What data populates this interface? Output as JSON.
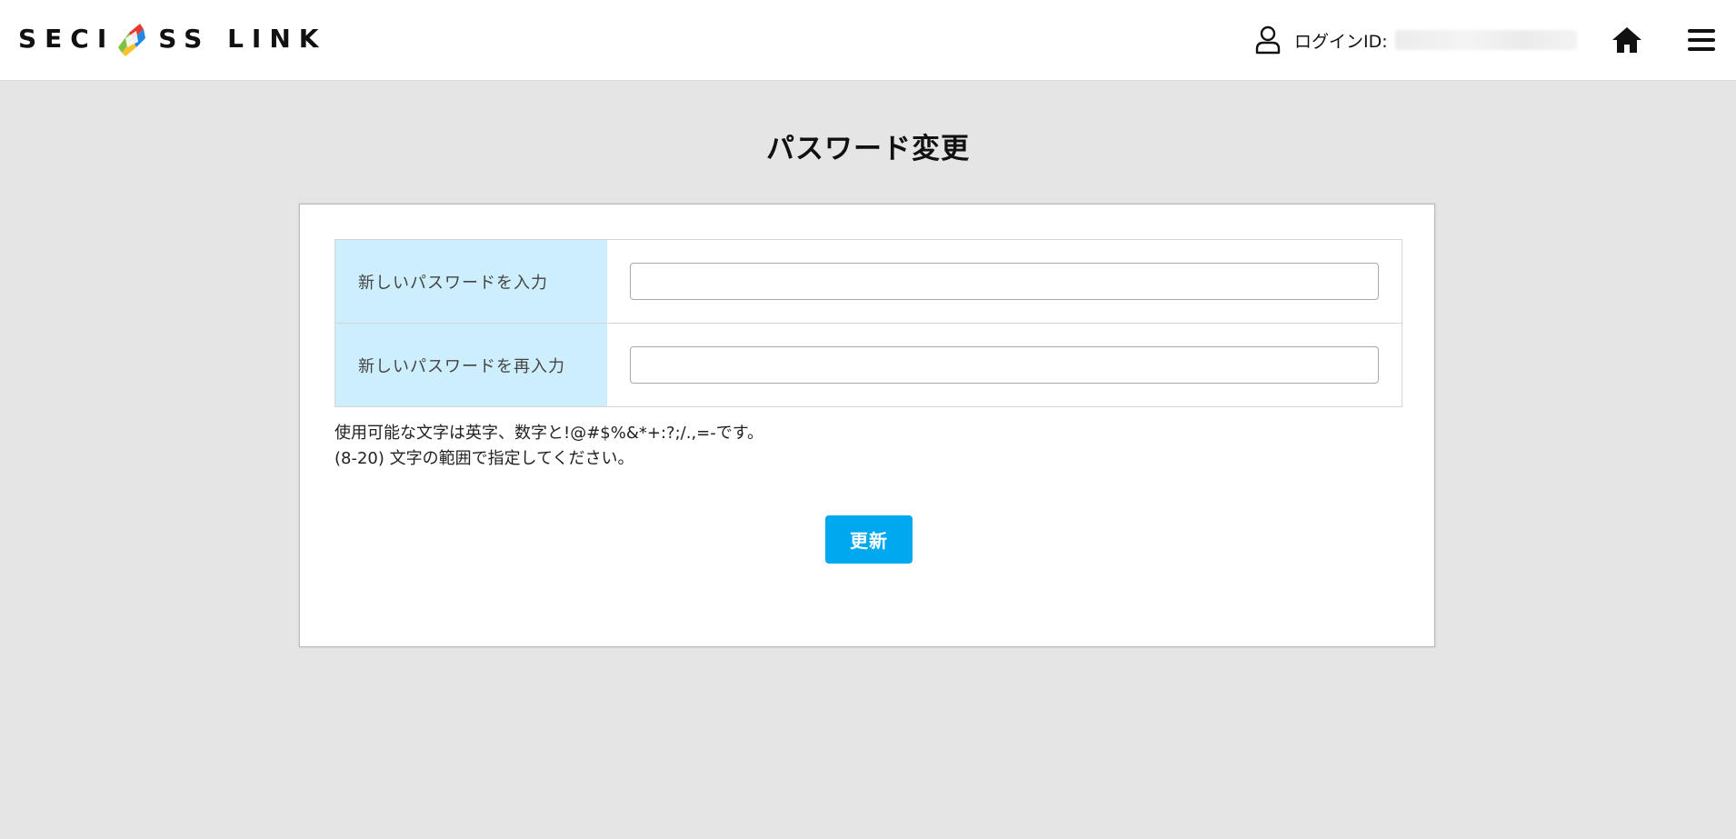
{
  "header": {
    "logo_text_part1": "SECI",
    "logo_text_part2": "SS LINK",
    "login_label": "ログインID:",
    "login_value_redacted": true
  },
  "page": {
    "title": "パスワード変更"
  },
  "form": {
    "new_password_label": "新しいパスワードを入力",
    "new_password_value": "",
    "confirm_password_label": "新しいパスワードを再入力",
    "confirm_password_value": ""
  },
  "notes": {
    "line1": "使用可能な文字は英字、数字と!@#$%&*+:?;/.,=-です。",
    "line2": "(8-20) 文字の範囲で指定してください。"
  },
  "actions": {
    "submit_label": "更新"
  },
  "colors": {
    "accent": "#00a8f0",
    "label_bg": "#cdeefc",
    "page_bg": "#e5e5e5"
  },
  "icons": {
    "user": "user-icon",
    "home": "home-icon",
    "menu": "hamburger-menu-icon"
  }
}
